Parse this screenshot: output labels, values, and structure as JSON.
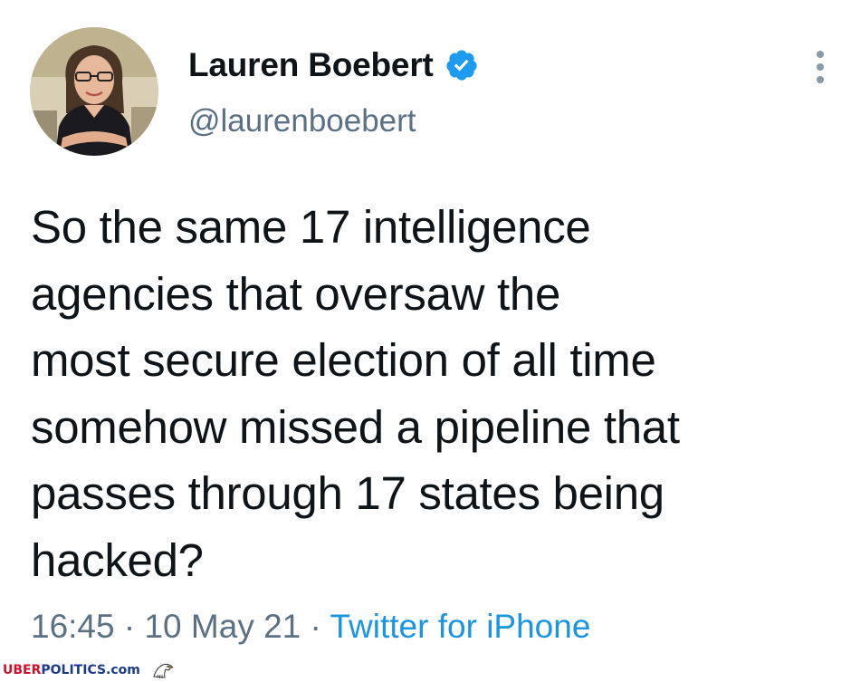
{
  "user": {
    "display_name": "Lauren Boebert",
    "handle": "@laurenboebert",
    "verified": true,
    "avatar": "profile-photo"
  },
  "tweet": {
    "lines": [
      "So the same 17 intelligence",
      "agencies that oversaw the",
      "most secure election of all time",
      "somehow missed a pipeline that",
      "passes through 17 states being",
      "hacked?"
    ],
    "time": "16:45",
    "separator": "·",
    "date": "10 May 21",
    "source": "Twitter for iPhone"
  },
  "icons": {
    "verified": "verified-badge-icon",
    "more": "more-options-icon"
  },
  "watermark": {
    "part1": "UBER",
    "part2": "POLITICS.com",
    "logo": "eagle-logo"
  },
  "colors": {
    "verified_blue": "#1d9bf0",
    "link_blue": "#1b95e0",
    "secondary_text": "#5b7083",
    "primary_text": "#0f1419",
    "watermark_red": "#d0102a",
    "watermark_blue": "#1b3a8c"
  }
}
